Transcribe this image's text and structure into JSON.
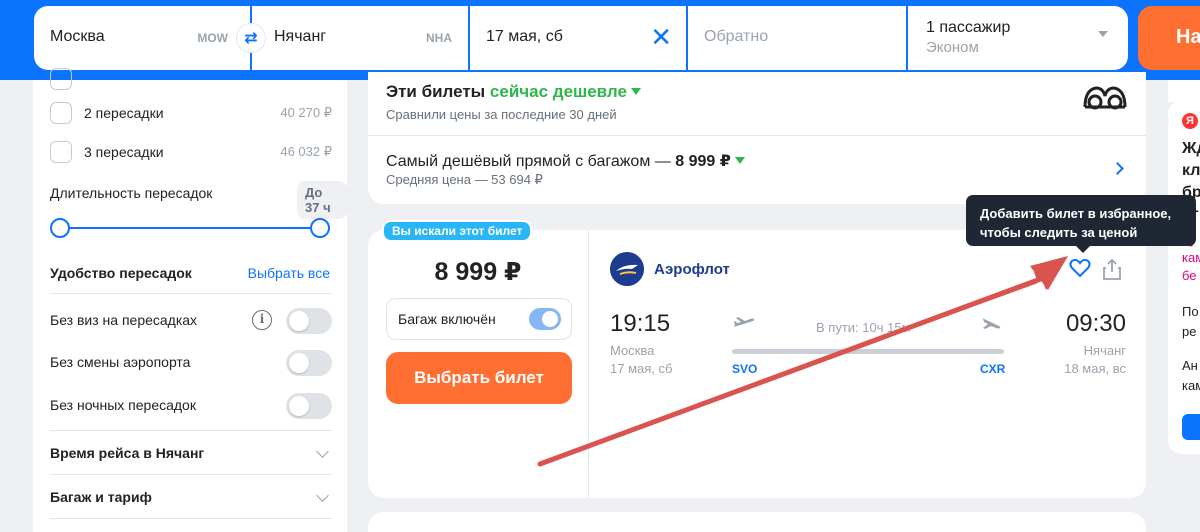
{
  "search": {
    "origin": "Москва",
    "origin_code": "MOW",
    "destination": "Нячанг",
    "destination_code": "NHA",
    "date": "17 мая, сб",
    "return_placeholder": "Обратно",
    "passengers": "1 пассажир",
    "cabin_class": "Эконом",
    "search_button_label": "На"
  },
  "filters": {
    "stops": [
      {
        "label": "2 пересадки",
        "price": "40 270 ₽"
      },
      {
        "label": "3 пересадки",
        "price": "46 032 ₽"
      }
    ],
    "layover_duration_label": "Длительность пересадок",
    "layover_duration_badge": "До 37 ч",
    "convenience_title": "Удобство пересадок",
    "select_all_label": "Выбрать все",
    "toggles": [
      {
        "label": "Без виз на пересадках",
        "checked": false
      },
      {
        "label": "Без смены аэропорта",
        "checked": false
      },
      {
        "label": "Без ночных пересадок",
        "checked": false
      }
    ],
    "sections": [
      "Время рейса в Нячанг",
      "Багаж и тариф"
    ]
  },
  "cheaper": {
    "title_prefix": "Эти билеты ",
    "title_highlight": "сейчас дешевле",
    "subtitle": "Сравнили цены за последние 30 дней",
    "direct_prefix": "Самый дешёвый прямой с багажом — ",
    "direct_price": "8 999 ₽",
    "direct_avg": "Средняя цена — 53 694 ₽"
  },
  "ticket": {
    "badge": "Вы искали этот билет",
    "price": "8 999 ₽",
    "baggage_label": "Багаж включён",
    "baggage_included": true,
    "buy_label": "Выбрать билет",
    "airline": "Аэрофлот",
    "dep_time": "19:15",
    "dep_city": "Москва",
    "dep_date": "17 мая, сб",
    "dep_code": "SVO",
    "duration": "В пути: 10ч 15м",
    "arr_time": "09:30",
    "arr_city": "Нячанг",
    "arr_date": "18 мая, вс",
    "arr_code": "CXR"
  },
  "tooltip": {
    "line1": "Добавить билет в избранное,",
    "line2": "чтобы следить за ценой"
  },
  "ad": {
    "logo_letter": "Я",
    "lines": [
      "Жд",
      "кл",
      "бр",
      "ст"
    ],
    "pink_lines": [
      "Ку",
      "кам",
      "бе"
    ],
    "small_lines": [
      "По",
      "ре",
      "Ан",
      "кам"
    ]
  },
  "colors": {
    "brand_blue": "#0c73fe",
    "accent_orange": "#ff6f32",
    "green": "#2fb64b",
    "annotation_red": "#d9534f"
  }
}
